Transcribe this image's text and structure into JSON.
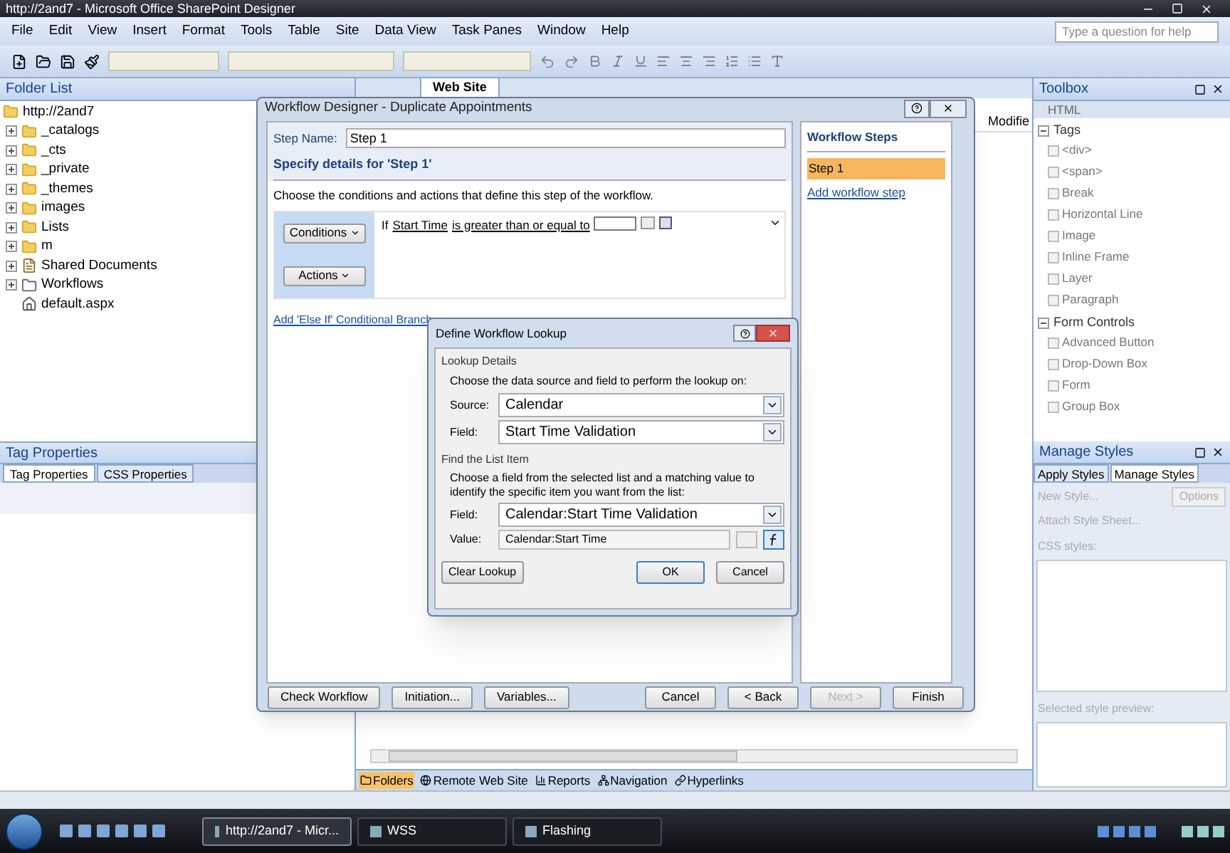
{
  "window": {
    "title": "http://2and7 - Microsoft Office SharePoint Designer"
  },
  "menu": [
    "File",
    "Edit",
    "View",
    "Insert",
    "Format",
    "Tools",
    "Table",
    "Site",
    "Data View",
    "Task Panes",
    "Window",
    "Help"
  ],
  "help_search": {
    "placeholder": "Type a question for help"
  },
  "folder_list": {
    "title": "Folder List",
    "items": [
      {
        "label": "http://2and7",
        "kind": "site",
        "children": [
          {
            "label": "_catalogs",
            "kind": "folder"
          },
          {
            "label": "_cts",
            "kind": "folder"
          },
          {
            "label": "_private",
            "kind": "folder"
          },
          {
            "label": "_themes",
            "kind": "folder"
          },
          {
            "label": "images",
            "kind": "folder"
          },
          {
            "label": "Lists",
            "kind": "folder"
          },
          {
            "label": "m",
            "kind": "folder"
          },
          {
            "label": "Shared Documents",
            "kind": "library"
          },
          {
            "label": "Workflows",
            "kind": "workflows"
          },
          {
            "label": "default.aspx",
            "kind": "page"
          }
        ]
      }
    ]
  },
  "tag_properties": {
    "title": "Tag Properties",
    "tabs": [
      {
        "label": "Tag Properties",
        "selected": true
      },
      {
        "label": "CSS Properties",
        "selected": false
      }
    ]
  },
  "editor": {
    "tab": "Web Site",
    "column_1": "Modifie",
    "views": [
      {
        "label": "Folders",
        "selected": true
      },
      {
        "label": "Remote Web Site",
        "selected": false
      },
      {
        "label": "Reports",
        "selected": false
      },
      {
        "label": "Navigation",
        "selected": false
      },
      {
        "label": "Hyperlinks",
        "selected": false
      }
    ]
  },
  "toolbox": {
    "title": "Toolbox",
    "header": "HTML",
    "groups": [
      {
        "label": "Tags",
        "expanded": true,
        "items": [
          "<div>",
          "<span>",
          "Break",
          "Horizontal Line",
          "Image",
          "Inline Frame",
          "Layer",
          "Paragraph"
        ]
      },
      {
        "label": "Form Controls",
        "expanded": true,
        "items": [
          "Advanced Button",
          "Drop-Down Box",
          "Form",
          "Group Box"
        ]
      }
    ]
  },
  "manage_styles": {
    "title": "Manage Styles",
    "tabs": [
      {
        "label": "Apply Styles",
        "selected": false
      },
      {
        "label": "Manage Styles",
        "selected": true
      }
    ],
    "new_style": "New Style...",
    "attach": "Attach Style Sheet...",
    "options": "Options",
    "css_label": "CSS styles:",
    "preview_label": "Selected style preview:"
  },
  "workflow_designer": {
    "title": "Workflow Designer - Duplicate Appointments",
    "step_name_label": "Step Name:",
    "step_name": "Step 1",
    "section": "Specify details for 'Step 1'",
    "description": "Choose the conditions and actions that define this step of the workflow.",
    "conditions_button": "Conditions",
    "actions_button": "Actions",
    "condition": {
      "if": "If",
      "field": "Start Time",
      "operator": "is greater than or equal to"
    },
    "else_link": "Add 'Else If' Conditional Branch",
    "steps_title": "Workflow Steps",
    "steps": [
      {
        "label": "Step 1",
        "selected": true
      }
    ],
    "add_step": "Add workflow step",
    "buttons": [
      {
        "label": "Check Workflow",
        "disabled": false
      },
      {
        "label": "Initiation...",
        "disabled": false
      },
      {
        "label": "Variables...",
        "disabled": false
      },
      {
        "label": "Cancel",
        "disabled": false
      },
      {
        "label": "< Back",
        "disabled": false
      },
      {
        "label": "Next >",
        "disabled": true
      },
      {
        "label": "Finish",
        "disabled": false
      }
    ]
  },
  "lookup_dialog": {
    "title": "Define Workflow Lookup",
    "details_title": "Lookup Details",
    "details_text": "Choose the data source and field to perform the lookup on:",
    "source_label": "Source:",
    "source": "Calendar",
    "field_label": "Field:",
    "field": "Start Time Validation",
    "find_title": "Find the List Item",
    "find_text": "Choose a field from the selected list and a matching value to identify the specific item you want from the list:",
    "find_field_label": "Field:",
    "find_field": "Calendar:Start Time Validation",
    "value_label": "Value:",
    "value": "Calendar:Start Time",
    "clear": "Clear Lookup",
    "ok": "OK",
    "cancel": "Cancel"
  },
  "taskbar": {
    "items": [
      {
        "label": "http://2and7 - Micr...",
        "selected": true
      },
      {
        "label": "WSS",
        "selected": false
      },
      {
        "label": "Flashing",
        "selected": false
      }
    ]
  }
}
